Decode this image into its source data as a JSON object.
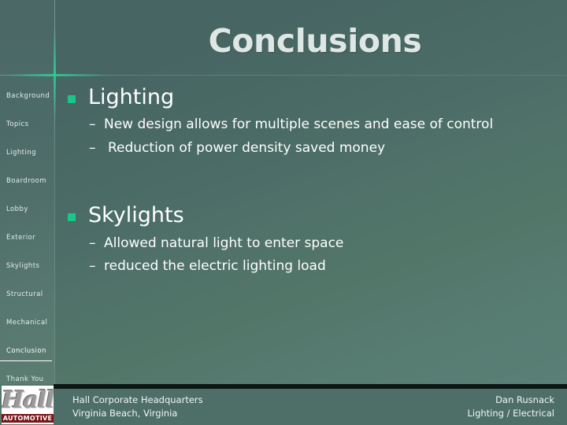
{
  "slide": {
    "title": "Conclusions",
    "accent_color": "#18c68a",
    "background_top_color": "#476562",
    "background_bottom_color": "#5a8178"
  },
  "sidebar": {
    "items": [
      {
        "label": "Background",
        "current": false
      },
      {
        "label": "Topics",
        "current": false
      },
      {
        "label": "Lighting",
        "current": false
      },
      {
        "label": "Boardroom",
        "current": false
      },
      {
        "label": "Lobby",
        "current": false
      },
      {
        "label": "Exterior",
        "current": false
      },
      {
        "label": "Skylights",
        "current": false
      },
      {
        "label": "Structural",
        "current": false
      },
      {
        "label": "Mechanical",
        "current": false
      },
      {
        "label": "Conclusion",
        "current": true
      },
      {
        "label": "Thank You",
        "current": false
      }
    ]
  },
  "content": {
    "groups": [
      {
        "heading": "Lighting",
        "sub_items": [
          "New design allows for multiple scenes and ease of control",
          "Reduction of power density saved money"
        ],
        "dash": "–"
      },
      {
        "heading": "Skylights",
        "sub_items": [
          "Allowed natural light to enter space",
          "reduced the electric lighting load"
        ],
        "dash": "–"
      }
    ]
  },
  "footer": {
    "left_line1": "Hall Corporate Headquarters",
    "left_line2": "Virginia Beach, Virginia",
    "right_line1": "Dan Rusnack",
    "right_line2": "Lighting / Electrical"
  },
  "logo": {
    "wordmark": "Hall",
    "banner": "AUTOMOTIVE",
    "banner_color": "#7a1418"
  }
}
